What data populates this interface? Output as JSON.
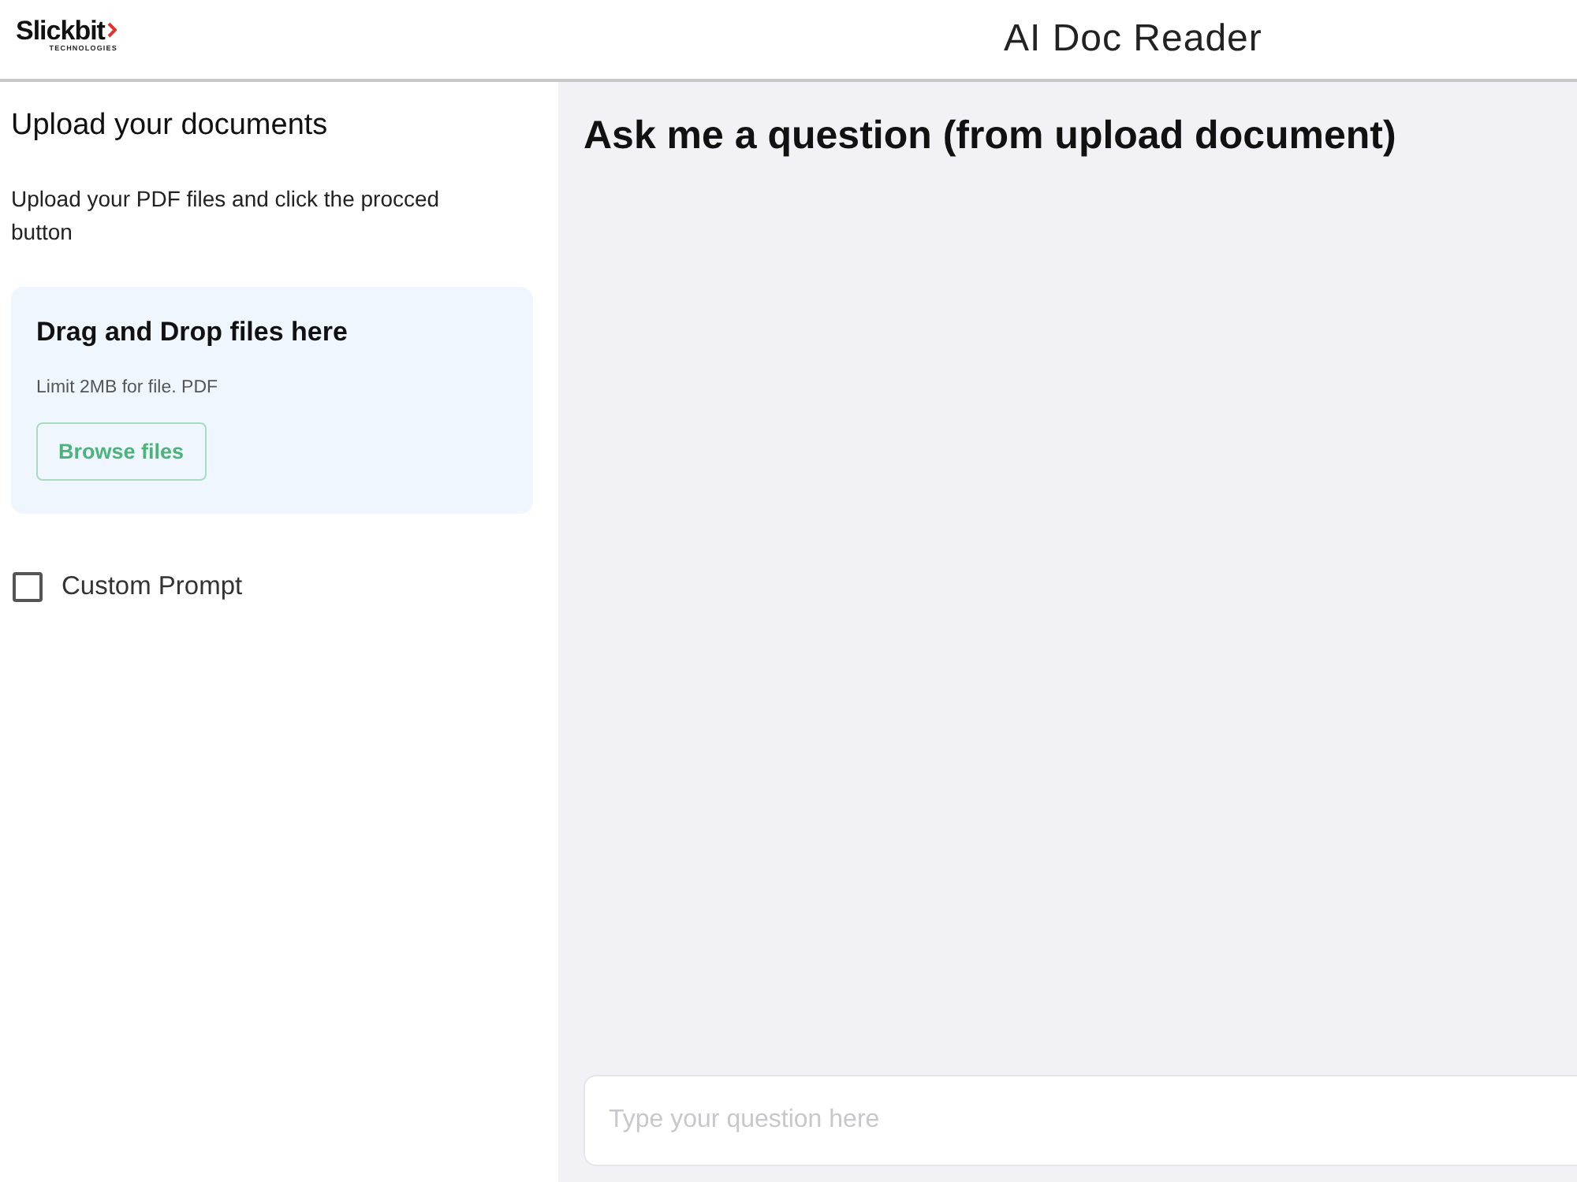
{
  "header": {
    "logo": {
      "name": "Slickbit",
      "tagline": "TECHNOLOGIES"
    },
    "title": "AI Doc Reader"
  },
  "sidebar": {
    "heading": "Upload your documents",
    "instructions": "Upload your PDF files and click the procced button",
    "dropzone": {
      "title": "Drag and Drop files here",
      "limit": "Limit 2MB for file. PDF",
      "button": "Browse files"
    },
    "options": [
      {
        "kind": "checkbox",
        "label": "Custom Prompt",
        "checked": false
      }
    ]
  },
  "main": {
    "heading": "Ask me a question (from upload document)",
    "question_input": {
      "placeholder": "Type your question here"
    }
  }
}
